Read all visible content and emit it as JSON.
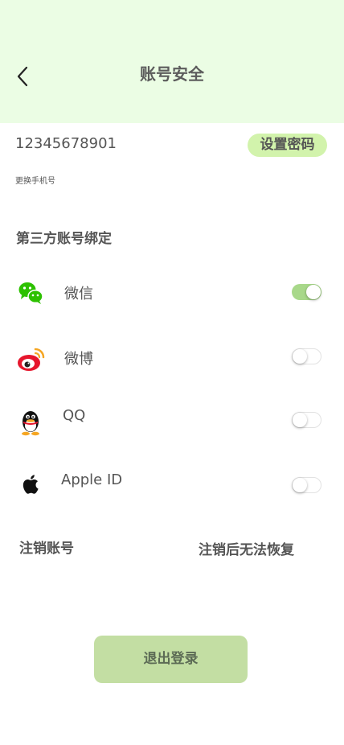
{
  "header": {
    "title": "账号安全",
    "back_icon": "chevron-left-icon"
  },
  "account": {
    "phone": "12345678901",
    "set_password_label": "设置密码",
    "change_phone_label": "更换手机号"
  },
  "third_party": {
    "section_title": "第三方账号绑定",
    "items": [
      {
        "label": "微信",
        "icon": "wechat-icon",
        "bound": true
      },
      {
        "label": "微博",
        "icon": "weibo-icon",
        "bound": false
      },
      {
        "label": "QQ",
        "icon": "qq-icon",
        "bound": false
      },
      {
        "label": "Apple  ID",
        "icon": "apple-icon",
        "bound": false
      }
    ]
  },
  "deactivate": {
    "label": "注销账号",
    "note": "注销后无法恢复"
  },
  "logout_label": "退出登录",
  "colors": {
    "header_bg": "#ebfde4",
    "accent": "#d2f3ac",
    "toggle_on": "#a8d88a",
    "logout_bg": "#c3dea3"
  }
}
